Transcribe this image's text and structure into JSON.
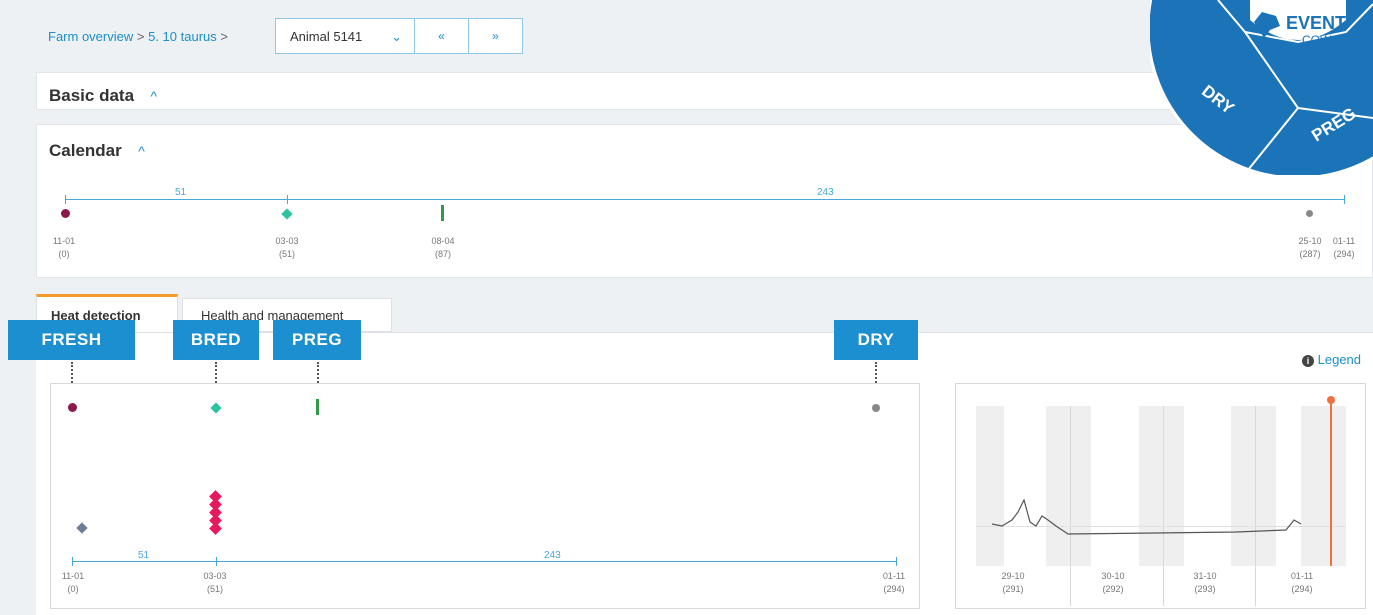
{
  "breadcrumb": {
    "farm_overview": "Farm overview",
    "sep1": ">",
    "group": "5. 10 taurus",
    "sep2": ">"
  },
  "animal_select": {
    "value": "Animal 5141"
  },
  "nav": {
    "prev": "«",
    "next": "»"
  },
  "sections": {
    "basic_data": "Basic data",
    "calendar": "Calendar"
  },
  "calendar": {
    "spans": [
      "51",
      "243"
    ],
    "ticks": [
      {
        "date": "11-01",
        "day": "(0)"
      },
      {
        "date": "03-03",
        "day": "(51)"
      },
      {
        "date": "08-04",
        "day": "(87)"
      },
      {
        "date": "25-10",
        "day": "(287)"
      },
      {
        "date": "01-11",
        "day": "(294)"
      }
    ]
  },
  "tabs": {
    "heat_detection": "Heat detection",
    "health_management": "Health and management"
  },
  "stages": [
    "FRESH",
    "BRED",
    "PREG",
    "DRY"
  ],
  "legend_link": "Legend",
  "heat_chart": {
    "spans": [
      "51",
      "243"
    ],
    "ticks": [
      {
        "date": "11-01",
        "day": "(0)"
      },
      {
        "date": "03-03",
        "day": "(51)"
      },
      {
        "date": "01-11",
        "day": "(294)"
      }
    ]
  },
  "mini_chart": {
    "ticks": [
      {
        "date": "29-10",
        "day": "(291)"
      },
      {
        "date": "30-10",
        "day": "(292)"
      },
      {
        "date": "31-10",
        "day": "(293)"
      },
      {
        "date": "01-11",
        "day": "(294)"
      }
    ]
  },
  "badge": {
    "brand": "EVENT",
    "sub": "COW",
    "dry": "DRY",
    "preg": "PREG"
  },
  "colors": {
    "accent": "#1a8fc9",
    "stage_blue": "#1b8fd0",
    "fresh": "#8b1a4a",
    "bred": "#2ec4a0",
    "preg": "#2e9a4a",
    "dry": "#888888",
    "heat": "#e8185f",
    "marker": "#f07040"
  }
}
